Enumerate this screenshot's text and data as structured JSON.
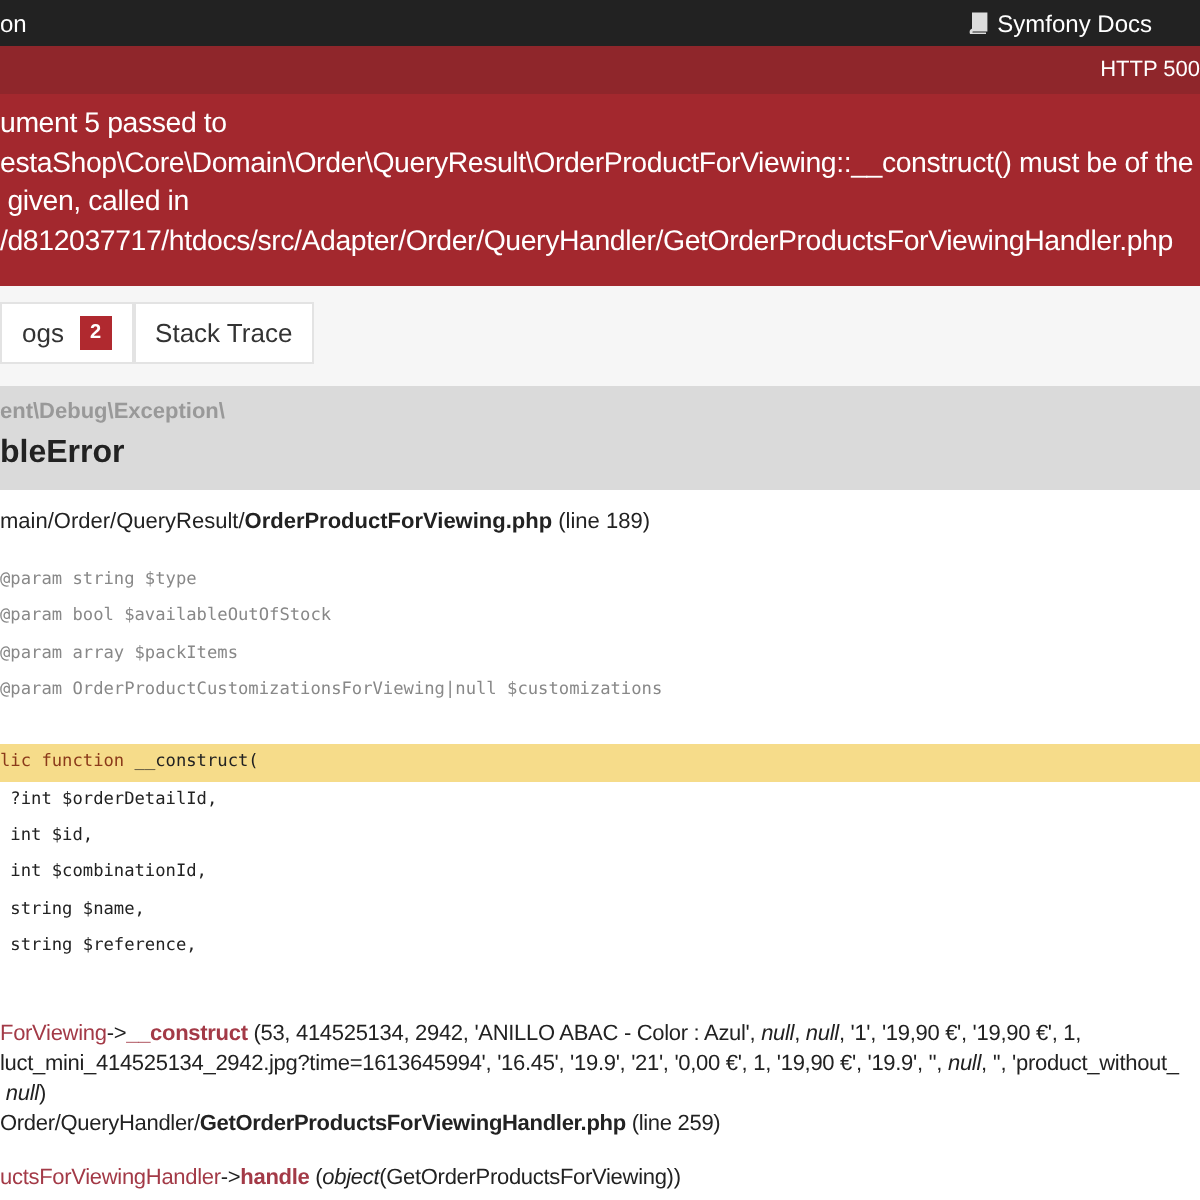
{
  "top_bar": {
    "left_text": "on",
    "docs_link": "Symfony Docs"
  },
  "header": {
    "status": "HTTP 500",
    "message_lines": [
      "ument 5 passed to",
      "estaShop\\Core\\Domain\\Order\\QueryResult\\OrderProductForViewing::__construct() must be of the",
      " given, called in",
      "/d812037717/htdocs/src/Adapter/Order/QueryHandler/GetOrderProductsForViewingHandler.php"
    ]
  },
  "tabs": [
    {
      "label": "ogs",
      "badge": "2",
      "selected": false
    },
    {
      "label": "Stack Trace",
      "selected": false
    }
  ],
  "exception": {
    "namespace": "ent\\Debug\\Exception\\",
    "class": "bleError"
  },
  "file": {
    "path": "main/Order/QueryResult/",
    "name": "OrderProductForViewing.php",
    "line": "(line 189)"
  },
  "code": [
    {
      "kind": "comment",
      "text": "@param string $type",
      "highlighted": false
    },
    {
      "kind": "comment",
      "text": "@param bool $availableOutOfStock",
      "highlighted": false
    },
    {
      "kind": "comment",
      "text": "@param array $packItems",
      "highlighted": false
    },
    {
      "kind": "comment",
      "text": "@param OrderProductCustomizationsForViewing|null $customizations",
      "highlighted": false
    },
    {
      "kind": "blank"
    },
    {
      "kind": "code",
      "keyword": "lic function",
      "text": " __construct(",
      "highlighted": true
    },
    {
      "kind": "code",
      "text": " ?int $orderDetailId,",
      "highlighted": false
    },
    {
      "kind": "code",
      "text": " int $id,",
      "highlighted": false
    },
    {
      "kind": "code",
      "text": " int $combinationId,",
      "highlighted": false
    },
    {
      "kind": "code",
      "text": " string $name,",
      "highlighted": false
    },
    {
      "kind": "code",
      "text": " string $reference,",
      "highlighted": false
    }
  ],
  "trace": [
    {
      "class": "ForViewing",
      "arrow": "->",
      "method": "__construct",
      "args": [
        "(53, 414525134, 2942, 'ANILLO ABAC - Color : Azul', *null*, *null*, '1', '19,90 €', '19,90 €', 1,",
        "luct_mini_414525134_2942.jpg?time=1613645994', '16.45', '19.9', '21', '0,00 €', 1, '19,90 €', '19.9', '', *null*, '', 'product_without_",
        " *null*)"
      ],
      "file_path": "Order/QueryHandler/",
      "file_name": "GetOrderProductsForViewingHandler.php",
      "file_line": "(line 259)"
    },
    {
      "class": "uctsForViewingHandler",
      "arrow": "->",
      "method": "handle",
      "args": [
        "(*object*(GetOrderProductsForViewing))"
      ]
    }
  ]
}
